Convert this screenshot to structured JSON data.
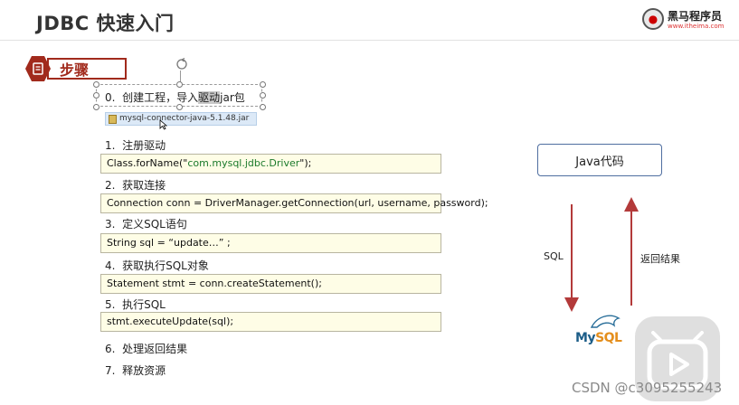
{
  "header": {
    "title": "JDBC 快速入门",
    "logo_name": "黑马程序员",
    "logo_url": "www.itheima.com"
  },
  "section": {
    "label": "步骤"
  },
  "steps": [
    {
      "num": "0.",
      "text_before": "创建工程，导入",
      "text_hl": "驱动",
      "text_after": "jar包"
    },
    {
      "num": "1.",
      "text": "注册驱动"
    },
    {
      "num": "2.",
      "text": "获取连接"
    },
    {
      "num": "3.",
      "text": "定义SQL语句"
    },
    {
      "num": "4.",
      "text": "获取执行SQL对象"
    },
    {
      "num": "5.",
      "text": "执行SQL"
    },
    {
      "num": "6.",
      "text": "处理返回结果"
    },
    {
      "num": "7.",
      "text": "释放资源"
    }
  ],
  "jar_file": "mysql-connector-java-5.1.48.jar",
  "code": {
    "c1_pre": "Class.forName(\"",
    "c1_str": "com.mysql.jdbc.Driver",
    "c1_post": "\");",
    "c2": "Connection conn = DriverManager.getConnection(url, username, password);",
    "c3": "String sql = “update…” ;",
    "c4": "Statement stmt = conn.createStatement();",
    "c5": "stmt.executeUpdate(sql);"
  },
  "diagram": {
    "java_box": "Java代码",
    "down_label": "SQL",
    "up_label": "返回结果",
    "db_logo_my": "My",
    "db_logo_sql": "SQL",
    "arrow_color": "#b33a3a"
  },
  "watermark": "CSDN @c3095255243",
  "colors": {
    "accent": "#a12a1c",
    "code_bg": "#fefde6",
    "box_border": "#4f6ea0"
  }
}
